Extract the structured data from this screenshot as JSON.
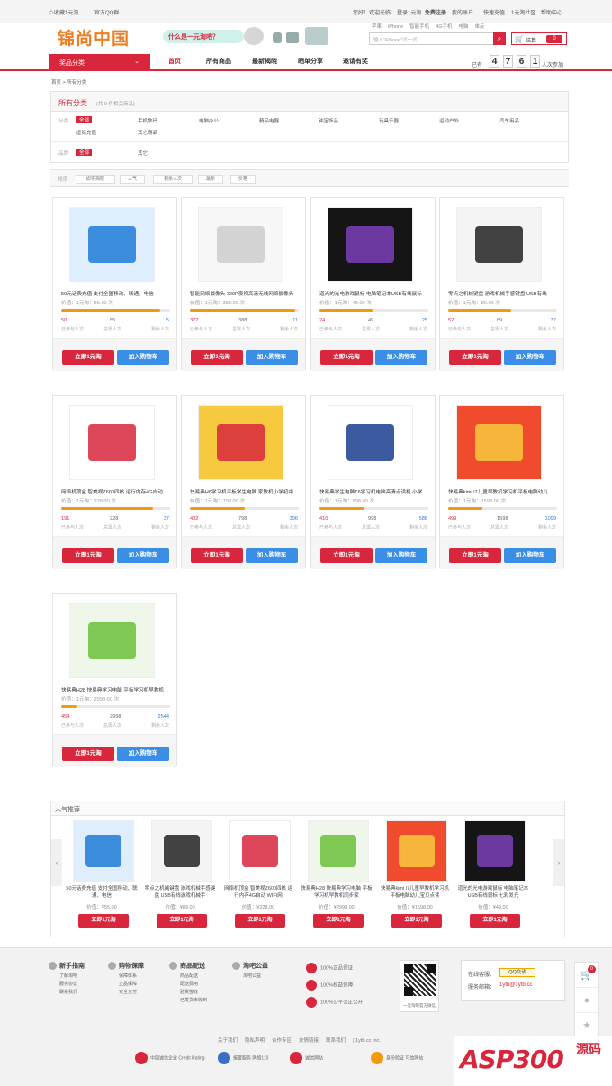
{
  "topbar": {
    "favorite": "☆收藏1元淘",
    "qq_group": "官方QQ群",
    "hello": "您好！欢迎光临!",
    "login": "登录1元淘",
    "register": "免费注册",
    "my_account": "我的账户",
    "recharge": "快速充值",
    "community": "1元淘社区",
    "help": "帮助中心"
  },
  "header": {
    "logo": "锦尚中国",
    "whatis": "什么是一元淘吧？",
    "hot_keywords": [
      "苹果",
      "iPhone",
      "智能手机",
      "4G手机",
      "电脑",
      "单反"
    ],
    "search_placeholder": "输入\"iPhone\"试一试",
    "cart_label": "结算",
    "cart_count": "0"
  },
  "nav": {
    "category": "奖品分类",
    "items": [
      "首页",
      "所有商品",
      "最新揭晓",
      "晒单分享",
      "邀请有奖"
    ],
    "joined_prefix": "已有",
    "digits": [
      "4",
      "7",
      "6",
      "1"
    ],
    "joined_suffix": "人次参加"
  },
  "breadcrumb": "首页 > 所有分类",
  "filter": {
    "title": "所有分类",
    "subtitle": "(共 9 件相关商品)",
    "category_label": "分类",
    "all": "全部",
    "categories": [
      "手机数码",
      "电脑办公",
      "精品电器",
      "钟宝饰品",
      "玩具乐器",
      "运动户外",
      "汽车用品",
      "虚拟充值",
      "其它商品"
    ],
    "brand_label": "品牌",
    "brand_all": "全部",
    "brands": [
      "其它"
    ],
    "sort_label": "排序",
    "sorts": [
      "即将揭晓",
      "人气",
      "剩余人次",
      "最新",
      "价格"
    ]
  },
  "products": [
    {
      "name": "50元话费充值 支付全国移动、联通、电信",
      "price": "价值：1元淘：55.00 次",
      "joined": "50",
      "total": "55",
      "remain": "5",
      "progress": 0.91
    },
    {
      "name": "智能网络摄像头 720P夜视高清无线网络摄像头",
      "price": "价值：1元淘：388.00 次",
      "joined": "377",
      "total": "388",
      "remain": "11",
      "progress": 0.97
    },
    {
      "name": "道光的光电游戏鼠标 电脑笔记本USB有线鼠标",
      "price": "价值：1元淘：49.00 次",
      "joined": "24",
      "total": "49",
      "remain": "25",
      "progress": 0.49
    },
    {
      "name": "零点之机械键盘 游戏机械手感键盘 USB有线",
      "price": "价值：1元淘：89.00 次",
      "joined": "52",
      "total": "89",
      "remain": "37",
      "progress": 0.58
    },
    {
      "name": "网络机顶盒 智美视Z600四核 运行内存4G自动",
      "price": "价值：1元淘：228.00 次",
      "joined": "191",
      "total": "228",
      "remain": "37",
      "progress": 0.84
    },
    {
      "name": "快易典H6学习机平板学生电脑 家教机小学初中",
      "price": "价值：1元淘：798.00 次",
      "joined": "402",
      "total": "798",
      "remain": "396",
      "progress": 0.5
    },
    {
      "name": "快易典学生电脑T6学习机电脑高清点读机 小学",
      "price": "价值：1元淘：998.00 次",
      "joined": "410",
      "total": "998",
      "remain": "588",
      "progress": 0.41
    },
    {
      "name": "快易典kimi i7儿童早教机学习机平板电脑幼儿",
      "price": "价值：1元淘：1598.00 次",
      "joined": "499",
      "total": "1598",
      "remain": "1099",
      "progress": 0.31
    },
    {
      "name": "快易典H28 快易典学习电脑 平板学习机早教机",
      "price": "价值：1元淘：2998.00 次",
      "joined": "454",
      "total": "2998",
      "remain": "2544",
      "progress": 0.15
    }
  ],
  "product_labels": {
    "joined": "已参与人次",
    "total": "总需人次",
    "remain": "剩余人次",
    "buy": "立即1元淘",
    "cart": "加入购物车"
  },
  "popular": {
    "title": "人气推荐",
    "prev": "‹",
    "next": "›",
    "items": [
      {
        "name": "50元话费充值 支付全国移动、联通、电信",
        "price": "价值：¥55.00"
      },
      {
        "name": "零点之机械键盘 游戏机械手感键盘 USB有线游戏机械手",
        "price": "价值：¥89.00"
      },
      {
        "name": "网络机顶盒 智美视Z600四核 运行内存4G自动 WIFI网",
        "price": "价值：¥228.00"
      },
      {
        "name": "快易典H28 快易典学习电脑 平板学习机早教机同步家",
        "price": "价值：¥2998.00"
      },
      {
        "name": "快易典kimi i7儿童早教机学习机平板电脑幼儿宝贝点读",
        "price": "价值：¥1598.00"
      },
      {
        "name": "道光的光电游戏鼠标 电脑笔记本USB有线鼠标 七彩发光",
        "price": "价值：¥49.00"
      }
    ],
    "buy": "立即1元淘"
  },
  "footer": {
    "cols": [
      {
        "title": "新手指南",
        "links": [
          "了解淘吧",
          "服务协议",
          "联系我们"
        ]
      },
      {
        "title": "购物保障",
        "links": [
          "保障体系",
          "正品保障",
          "安全支付"
        ]
      },
      {
        "title": "商品配送",
        "links": [
          "商品配送",
          "配送费用",
          "验货签收",
          "已发货未收到"
        ]
      },
      {
        "title": "淘吧公益",
        "links": [
          "淘吧公益"
        ]
      }
    ],
    "guarantees": [
      "100%正品保证",
      "100%权益保障",
      "100%公平公正公开"
    ],
    "qr_text": "一元淘吧官方微信",
    "service_label": "在线客服：",
    "qq_label": "QQ交谈",
    "email_label": "服务邮箱：",
    "email": "1ytb@1ytb.cc",
    "links": [
      "关于我们",
      "隐私声明",
      "合作专区",
      "友情链接",
      "联系我们",
      "| 1ytb.cc Inc."
    ],
    "badges": [
      "中国诚信企业 Credit Rating",
      "报警服务 网络110",
      "诚信网站",
      "身份验证 可信网站",
      ""
    ],
    "cart_badge": "0"
  },
  "watermark": {
    "text": "ASP300",
    "sub": "源码"
  },
  "colors": {
    "brand": "#d8273c",
    "accent_blue": "#3a8ee6",
    "progress": "#f29b0a",
    "logo": "#ee7d22"
  }
}
